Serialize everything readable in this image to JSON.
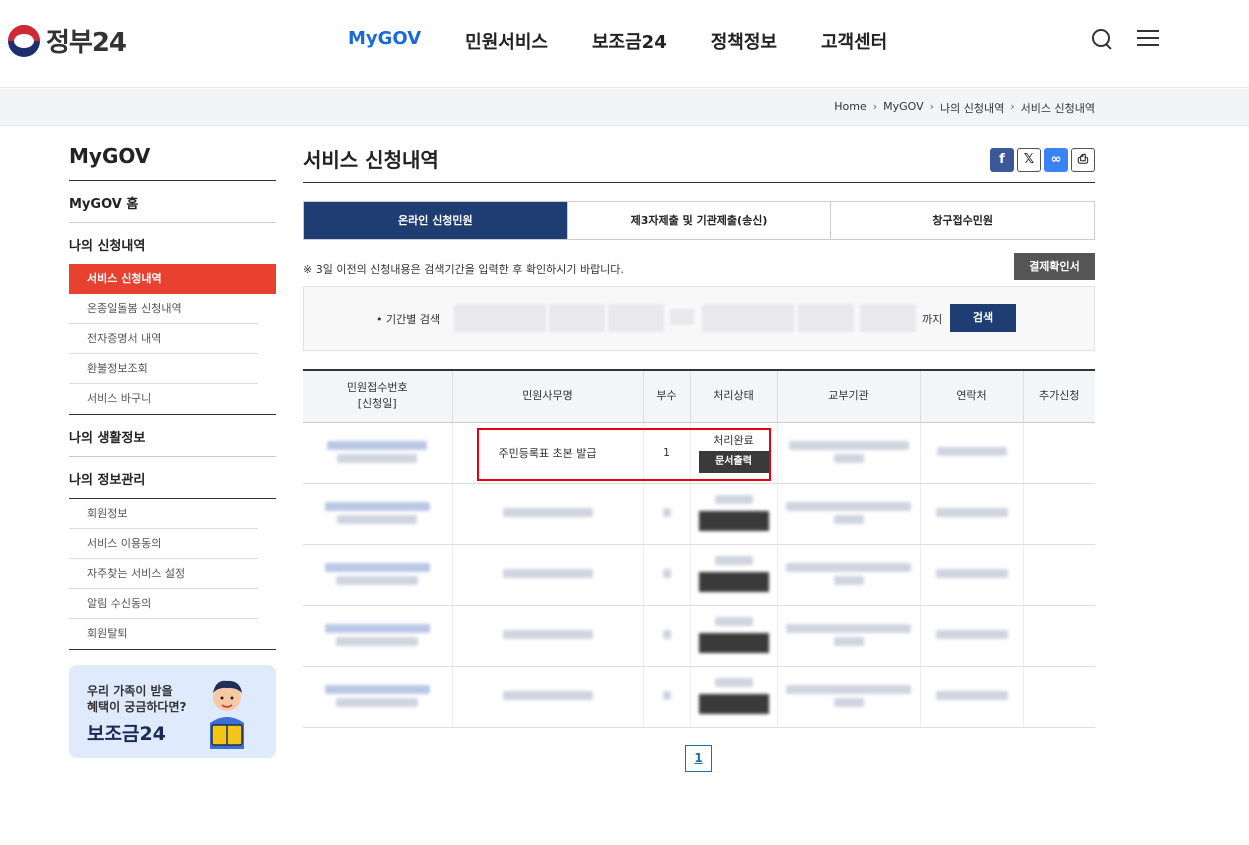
{
  "header": {
    "logo_text": "정부24",
    "nav": [
      {
        "label": "MyGOV",
        "active": true
      },
      {
        "label": "민원서비스",
        "active": false
      },
      {
        "label": "보조금24",
        "active": false
      },
      {
        "label": "정책정보",
        "active": false
      },
      {
        "label": "고객센터",
        "active": false
      }
    ]
  },
  "breadcrumb": [
    "Home",
    "MyGOV",
    "나의 신청내역",
    "서비스 신청내역"
  ],
  "sidebar": {
    "title": "MyGOV",
    "home": "MyGOV 홈",
    "group1": "나의 신청내역",
    "group1_items": [
      "서비스 신청내역",
      "온종일돌봄 신청내역",
      "전자증명서 내역",
      "환불정보조회",
      "서비스 바구니"
    ],
    "group2": "나의 생활정보",
    "group3": "나의 정보관리",
    "group3_items": [
      "회원정보",
      "서비스 이용동의",
      "자주찾는 서비스 설정",
      "알림 수신동의",
      "회원탈퇴"
    ],
    "banner_line1": "우리 가족이 받을",
    "banner_line2": "혜택이 궁금하다면?",
    "banner_line3": "보조금24"
  },
  "main": {
    "title": "서비스 신청내역",
    "share_icons": [
      "facebook-icon",
      "x-icon",
      "link-icon",
      "print-icon"
    ],
    "tabs": [
      {
        "label": "온라인 신청민원",
        "active": true
      },
      {
        "label": "제3자제출 및 기관제출(송신)",
        "active": false
      },
      {
        "label": "창구접수민원",
        "active": false
      }
    ],
    "notice": "※ 3일 이전의 신청내용은 검색기간을 입력한 후 확인하시기 바랍니다.",
    "pay_button": "결제확인서",
    "search_label": "• 기간별 검색",
    "search_until": "까지",
    "search_button": "검색",
    "columns": [
      "민원접수번호\n[신청일]",
      "민원사무명",
      "부수",
      "처리상태",
      "교부기관",
      "연락처",
      "추가신청"
    ],
    "first_row": {
      "name": "주민등록표 초본 발급",
      "count": "1",
      "status": "처리완료",
      "print_label": "문서출력"
    },
    "page": "1"
  },
  "colors": {
    "accent": "#1a6bd6",
    "navy": "#1e3e73",
    "red": "#e8412f"
  }
}
